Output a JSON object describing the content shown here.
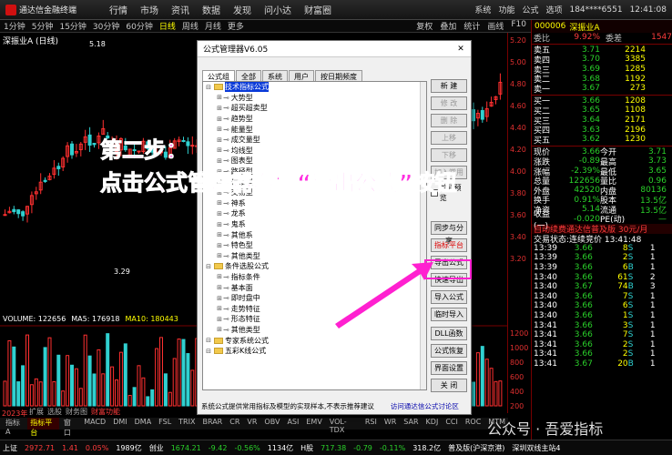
{
  "app": {
    "name": "通达信金融终端",
    "menus": [
      "行情",
      "市场",
      "资讯",
      "数据",
      "发现",
      "问小达",
      "财富圈"
    ],
    "right": [
      "系统",
      "功能",
      "公式",
      "选项"
    ],
    "account": "184****6551",
    "clock": "12:41:08"
  },
  "periods": [
    "1分钟",
    "5分钟",
    "15分钟",
    "30分钟",
    "60分钟",
    "日线",
    "周线",
    "月线",
    "更多"
  ],
  "tools": [
    "复权",
    "叠加",
    "统计",
    "画线",
    "F10"
  ],
  "chart": {
    "title": "深振业A (日线)",
    "high_label": "5.18",
    "low_label": "3.29",
    "axis": [
      "5.20",
      "5.00",
      "4.80",
      "4.60",
      "4.40",
      "4.20",
      "4.00",
      "3.80",
      "3.60",
      "3.40",
      "3.20"
    ],
    "vol_axis": [
      "1200",
      "1000",
      "800",
      "600",
      "400",
      "200"
    ],
    "year": "2023年"
  },
  "volume": {
    "label": "VOLUME: 122656",
    "ma5": "MA5: 176918",
    "ma10": "MA10: 180443"
  },
  "bottom_tabs": [
    "指标A",
    "指标平台",
    "窗口",
    "MACD",
    "DMI",
    "DMA",
    "FSL",
    "TRIX",
    "BRAR",
    "CR",
    "VR",
    "OBV",
    "ASI",
    "EMV",
    "VOL-TDX",
    "RSI",
    "WR",
    "SAR",
    "KDJ",
    "CCI",
    "ROC",
    "MTM"
  ],
  "sub_tabs": [
    "扩展",
    "选股",
    "财务图",
    "财富功能"
  ],
  "statusbar": {
    "idx1_name": "上证",
    "idx1": "2972.71",
    "idx1_chg": "1.41",
    "idx1_pct": "0.05%",
    "idx1_amt": "1989亿",
    "idx2_name": "创业",
    "idx2": "1674.21",
    "idx2_chg": "-9.42",
    "idx2_pct": "-0.56%",
    "idx2_amt": "1134亿",
    "idx3_name": "H股",
    "idx3": "717.38",
    "idx3_chg": "-0.79",
    "idx3_pct": "-0.11%",
    "idx3_amt": "318.2亿",
    "msg": "普及版(沪深京港)",
    "server": "深圳双线主站4"
  },
  "dialog": {
    "title": "公式管理器V6.05",
    "tabs": [
      "公式组",
      "全部",
      "系统",
      "用户",
      "按日期频度"
    ],
    "tree": [
      {
        "t": "技术指标公式",
        "lvl": 0,
        "folder": true,
        "sel": true
      },
      {
        "t": "大势型",
        "lvl": 1
      },
      {
        "t": "超买超卖型",
        "lvl": 1
      },
      {
        "t": "趋势型",
        "lvl": 1
      },
      {
        "t": "能量型",
        "lvl": 1
      },
      {
        "t": "成交量型",
        "lvl": 1
      },
      {
        "t": "均线型",
        "lvl": 1
      },
      {
        "t": "图表型",
        "lvl": 1
      },
      {
        "t": "路径型",
        "lvl": 1
      },
      {
        "t": "停损型",
        "lvl": 1
      },
      {
        "t": "交易型",
        "lvl": 1
      },
      {
        "t": "神系",
        "lvl": 1
      },
      {
        "t": "龙系",
        "lvl": 1
      },
      {
        "t": "鬼系",
        "lvl": 1
      },
      {
        "t": "其他系",
        "lvl": 1
      },
      {
        "t": "特色型",
        "lvl": 1
      },
      {
        "t": "其他类型",
        "lvl": 1
      },
      {
        "t": "条件选股公式",
        "lvl": 0,
        "folder": true
      },
      {
        "t": "指标条件",
        "lvl": 1
      },
      {
        "t": "基本面",
        "lvl": 1
      },
      {
        "t": "即时盘中",
        "lvl": 1
      },
      {
        "t": "走势特征",
        "lvl": 1
      },
      {
        "t": "形态特征",
        "lvl": 1
      },
      {
        "t": "其他类型",
        "lvl": 1
      },
      {
        "t": "专家系统公式",
        "lvl": 0,
        "folder": true
      },
      {
        "t": "五彩K线公式",
        "lvl": 0,
        "folder": true
      }
    ],
    "buttons": {
      "new": "新 建",
      "modify": "修 改",
      "delete": "删 除",
      "up": "上移",
      "down": "下移",
      "add_list": "加入常用",
      "preview": "关联预览",
      "sync": "同步与分享",
      "platform": "指标平台",
      "export": "导出公式",
      "quick_export": "快速导出",
      "import": "导入公式",
      "temp_import": "临时导入",
      "dll": "DLL函数",
      "restore": "公式恢复",
      "ui": "界面设置",
      "close": "关 闭"
    },
    "status": "系统公式提供常用指标及模型的实现样本,不表示推荐建议",
    "link": "访问通达信公式讨论区"
  },
  "overlay": {
    "step": "第二步：",
    "instruction": "点击公式管理器右侧“导出公式”按钮"
  },
  "quote": {
    "code": "000006",
    "name": "深振业A",
    "wb_label": "委比",
    "wb": "9.92%",
    "wc_label": "委差",
    "wc": "1547",
    "asks": [
      [
        "卖五",
        "3.71",
        "2214"
      ],
      [
        "卖四",
        "3.70",
        "3385"
      ],
      [
        "卖三",
        "3.69",
        "1285"
      ],
      [
        "卖二",
        "3.68",
        "1192"
      ],
      [
        "卖一",
        "3.67",
        "273"
      ]
    ],
    "bids": [
      [
        "买一",
        "3.66",
        "1208"
      ],
      [
        "买二",
        "3.65",
        "1108"
      ],
      [
        "买三",
        "3.64",
        "2171"
      ],
      [
        "买四",
        "3.63",
        "2196"
      ],
      [
        "买五",
        "3.62",
        "1230"
      ]
    ],
    "stats": [
      [
        "现价",
        "3.66",
        "今开",
        "3.71"
      ],
      [
        "涨跌",
        "-0.89",
        "最高",
        "3.73"
      ],
      [
        "涨幅",
        "-2.39%",
        "最低",
        "3.65"
      ],
      [
        "总量",
        "122656",
        "量比",
        "0.96"
      ],
      [
        "外盘",
        "42520",
        "内盘",
        "80136"
      ],
      [
        "换手",
        "0.91%",
        "股本",
        "13.5亿"
      ],
      [
        "净资",
        "5.14",
        "流通",
        "13.5亿"
      ],
      [
        "收益(一)",
        "-0.020",
        "PE(动)",
        "—"
      ]
    ],
    "promo": "自动续费通达信普及版 30元/月",
    "trade_state": "交易状态:连续竞价 13:41:48",
    "ticks": [
      [
        "13:39",
        "3.66",
        "8",
        "S",
        "1"
      ],
      [
        "13:39",
        "3.66",
        "2",
        "S",
        "1"
      ],
      [
        "13:39",
        "3.66",
        "6",
        "B",
        "1"
      ],
      [
        "13:40",
        "3.66",
        "61",
        "S",
        "2"
      ],
      [
        "13:40",
        "3.67",
        "74",
        "B",
        "3"
      ],
      [
        "13:40",
        "3.66",
        "7",
        "S",
        "1"
      ],
      [
        "13:40",
        "3.66",
        "6",
        "S",
        "1"
      ],
      [
        "13:40",
        "3.66",
        "1",
        "S",
        "1"
      ],
      [
        "13:41",
        "3.66",
        "3",
        "S",
        "1"
      ],
      [
        "13:41",
        "3.66",
        "7",
        "S",
        "1"
      ],
      [
        "13:41",
        "3.66",
        "2",
        "S",
        "1"
      ],
      [
        "13:41",
        "3.66",
        "2",
        "S",
        "1"
      ],
      [
        "13:41",
        "3.67",
        "20",
        "B",
        "1"
      ]
    ]
  },
  "watermark": "公众号 · 吾爱指标"
}
